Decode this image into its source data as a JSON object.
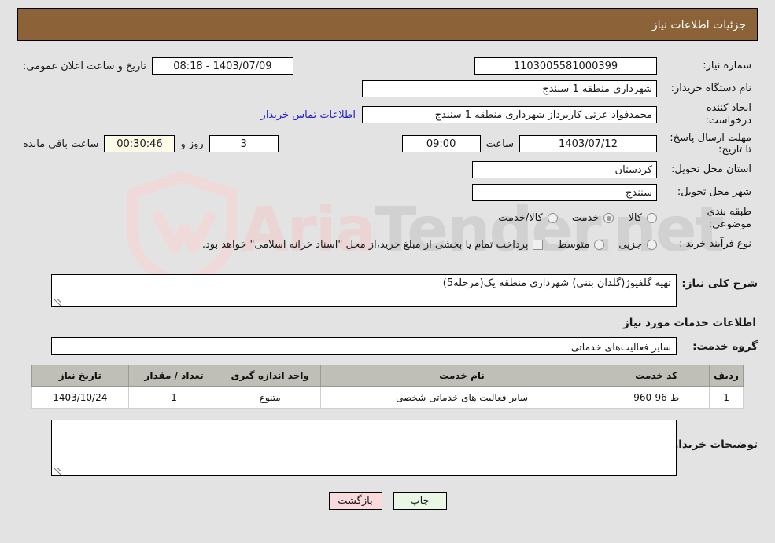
{
  "header": {
    "title": "جزئیات اطلاعات نیاز"
  },
  "watermark": {
    "text_a": "Aria",
    "text_b": "Tender",
    "text_c": ".net"
  },
  "form": {
    "need_number_label": "شماره نیاز:",
    "need_number_value": "1103005581000399",
    "public_announce_label": "تاریخ و ساعت اعلان عمومی:",
    "public_announce_value": "08:18 - 1403/07/09",
    "buyer_org_label": "نام دستگاه خریدار:",
    "buyer_org_value": "شهرداری منطقه 1 سنندج",
    "creator_label": "ایجاد کننده درخواست:",
    "creator_value": "محمدفواد عزتی کاربرداز شهرداری منطقه 1 سنندج",
    "contact_link": "اطلاعات تماس خریدار",
    "deadline_label": "مهلت ارسال پاسخ: تا تاریخ:",
    "deadline_date": "1403/07/12",
    "hour_label": "ساعت",
    "deadline_time": "09:00",
    "remaining_days": "3",
    "days_and_label": "روز و",
    "remaining_time": "00:30:46",
    "remaining_suffix": "ساعت باقی مانده",
    "province_label": "استان محل تحویل:",
    "province_value": "کردستان",
    "city_label": "شهر محل تحویل:",
    "city_value": "سنندج",
    "category_label": "طبقه بندی موضوعی:",
    "category_options": [
      {
        "label": "کالا",
        "checked": false
      },
      {
        "label": "خدمت",
        "checked": true
      },
      {
        "label": "کالا/خدمت",
        "checked": false
      }
    ],
    "process_label": "نوع فرآیند خرید :",
    "process_options": [
      {
        "label": "جزیی",
        "checked": false
      },
      {
        "label": "متوسط",
        "checked": false
      }
    ],
    "treasury_checkbox_text": "پرداخت تمام یا بخشی از مبلغ خرید،از محل \"اسناد خزانه اسلامی\" خواهد بود.",
    "treasury_checked": false
  },
  "details": {
    "need_desc_label": "شرح کلی نیاز:",
    "need_desc_value": "تهیه گلفیوژ(گلدان بتنی) شهرداری منطقه یک(مرحله5)",
    "services_heading": "اطلاعات خدمات مورد نیاز",
    "service_group_label": "گروه خدمت:",
    "service_group_value": "سایر فعالیت‌های خدماتی",
    "buyer_notes_label": "توضیحات خریدار:",
    "buyer_notes_value": ""
  },
  "table": {
    "columns": [
      "ردیف",
      "کد خدمت",
      "نام خدمت",
      "واحد اندازه گیری",
      "تعداد / مقدار",
      "تاریخ نیاز"
    ],
    "rows": [
      {
        "index": "1",
        "code": "ط-96-960",
        "name": "سایر فعالیت های خدماتی شخصی",
        "unit": "متنوع",
        "qty": "1",
        "need_date": "1403/10/24"
      }
    ]
  },
  "footer": {
    "print_label": "چاپ",
    "back_label": "بازگشت"
  }
}
